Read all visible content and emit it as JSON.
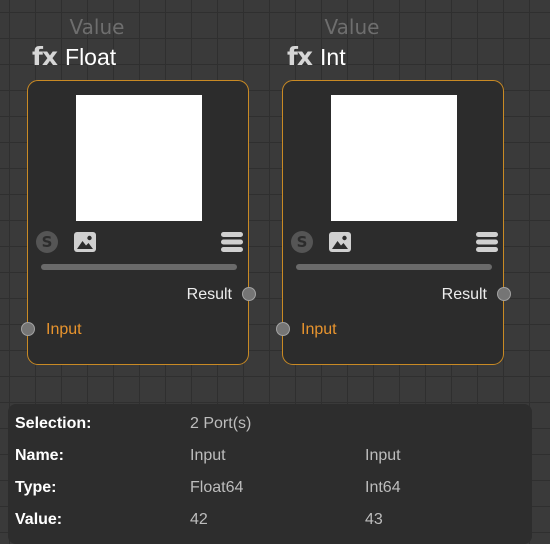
{
  "nodes": [
    {
      "subtitle": "Value",
      "fx_icon": "fx",
      "title": "Float",
      "tools": {
        "s_label": "S",
        "image_icon": "image-icon",
        "menu_icon": "menu-icon"
      },
      "output_port": "Result",
      "input_port": "Input"
    },
    {
      "subtitle": "Value",
      "fx_icon": "fx",
      "title": "Int",
      "tools": {
        "s_label": "S",
        "image_icon": "image-icon",
        "menu_icon": "menu-icon"
      },
      "output_port": "Result",
      "input_port": "Input"
    }
  ],
  "info": {
    "selection": {
      "label": "Selection:",
      "value": "2 Port(s)"
    },
    "name": {
      "label": "Name:",
      "values": [
        "Input",
        "Input"
      ]
    },
    "type": {
      "label": "Type:",
      "values": [
        "Float64",
        "Int64"
      ]
    },
    "value": {
      "label": "Value:",
      "values": [
        "42",
        "43"
      ]
    }
  },
  "colors": {
    "node_border": "#c98a24",
    "input_port_label": "#e8942e",
    "canvas": "#3a3a3a"
  }
}
